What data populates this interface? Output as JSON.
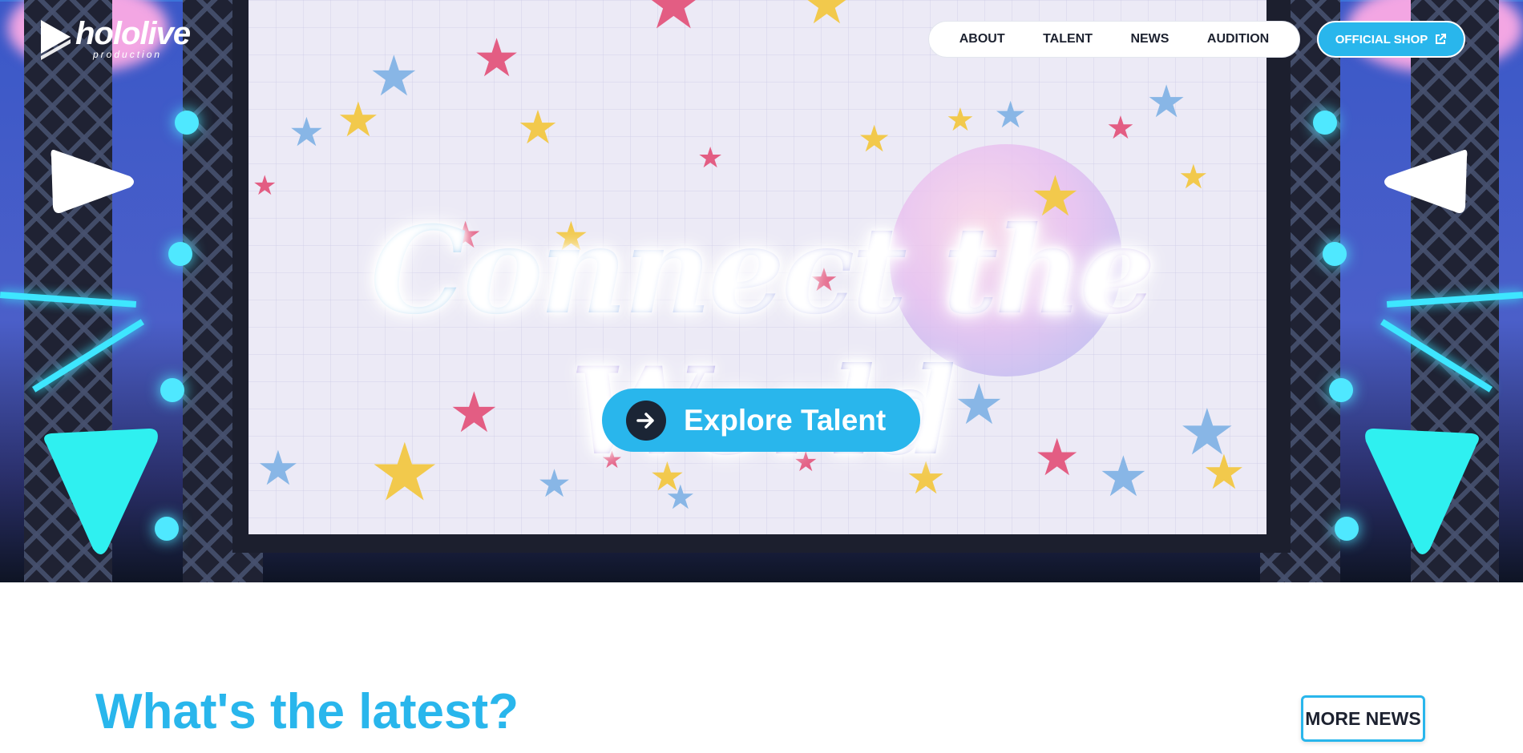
{
  "brand": {
    "logo_text": "hololive",
    "logo_subtext": "production"
  },
  "nav": {
    "items": [
      {
        "label": "ABOUT"
      },
      {
        "label": "TALENT"
      },
      {
        "label": "NEWS"
      },
      {
        "label": "AUDITION"
      }
    ],
    "shop_label": "OFFICIAL SHOP"
  },
  "hero": {
    "title": "Connect the World",
    "cta_label": "Explore Talent"
  },
  "latest": {
    "heading": "What's the latest?",
    "more_label": "MORE NEWS"
  },
  "colors": {
    "accent": "#29b6ec",
    "dark": "#1d2230",
    "white": "#ffffff"
  },
  "icons": {
    "cta": "arrow-right-icon",
    "shop": "external-link-icon",
    "logo": "play-triangle-icon"
  }
}
